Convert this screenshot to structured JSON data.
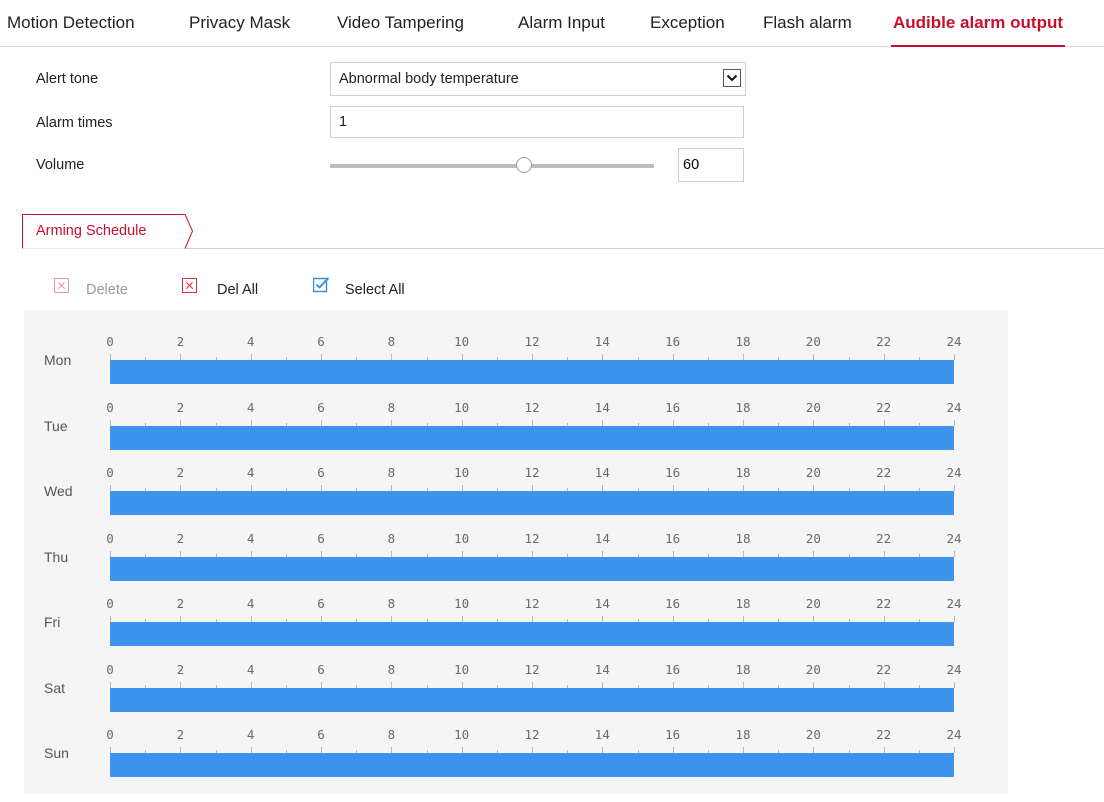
{
  "tabs": [
    {
      "label": "Motion Detection",
      "active": false
    },
    {
      "label": "Privacy Mask",
      "active": false
    },
    {
      "label": "Video Tampering",
      "active": false
    },
    {
      "label": "Alarm Input",
      "active": false
    },
    {
      "label": "Exception",
      "active": false
    },
    {
      "label": "Flash alarm",
      "active": false
    },
    {
      "label": "Audible alarm output",
      "active": true
    }
  ],
  "form": {
    "alert_tone_label": "Alert tone",
    "alert_tone_value": "Abnormal body temperature",
    "alarm_times_label": "Alarm times",
    "alarm_times_value": "1",
    "volume_label": "Volume",
    "volume_value": "60",
    "volume_level": 0.6
  },
  "schedule": {
    "tab_label": "Arming Schedule",
    "delete_label": "Delete",
    "del_all_label": "Del All",
    "select_all_label": "Select All",
    "hours": [
      "0",
      "2",
      "4",
      "6",
      "8",
      "10",
      "12",
      "14",
      "16",
      "18",
      "20",
      "22",
      "24"
    ],
    "days": [
      {
        "label": "Mon",
        "segments": [
          [
            0,
            24
          ]
        ]
      },
      {
        "label": "Tue",
        "segments": [
          [
            0,
            24
          ]
        ]
      },
      {
        "label": "Wed",
        "segments": [
          [
            0,
            24
          ]
        ]
      },
      {
        "label": "Thu",
        "segments": [
          [
            0,
            24
          ]
        ]
      },
      {
        "label": "Fri",
        "segments": [
          [
            0,
            24
          ]
        ]
      },
      {
        "label": "Sat",
        "segments": [
          [
            0,
            24
          ]
        ]
      },
      {
        "label": "Sun",
        "segments": [
          [
            0,
            24
          ]
        ]
      }
    ]
  },
  "colors": {
    "accent": "#c8102e",
    "schedule_bar": "#3d93ee",
    "select_all_icon": "#2f8fd8"
  },
  "icons": {
    "caret": "chevron-down-icon",
    "delete": "delete-x-icon",
    "del_all": "delete-all-x-icon",
    "select_all": "checkbox-check-icon"
  }
}
